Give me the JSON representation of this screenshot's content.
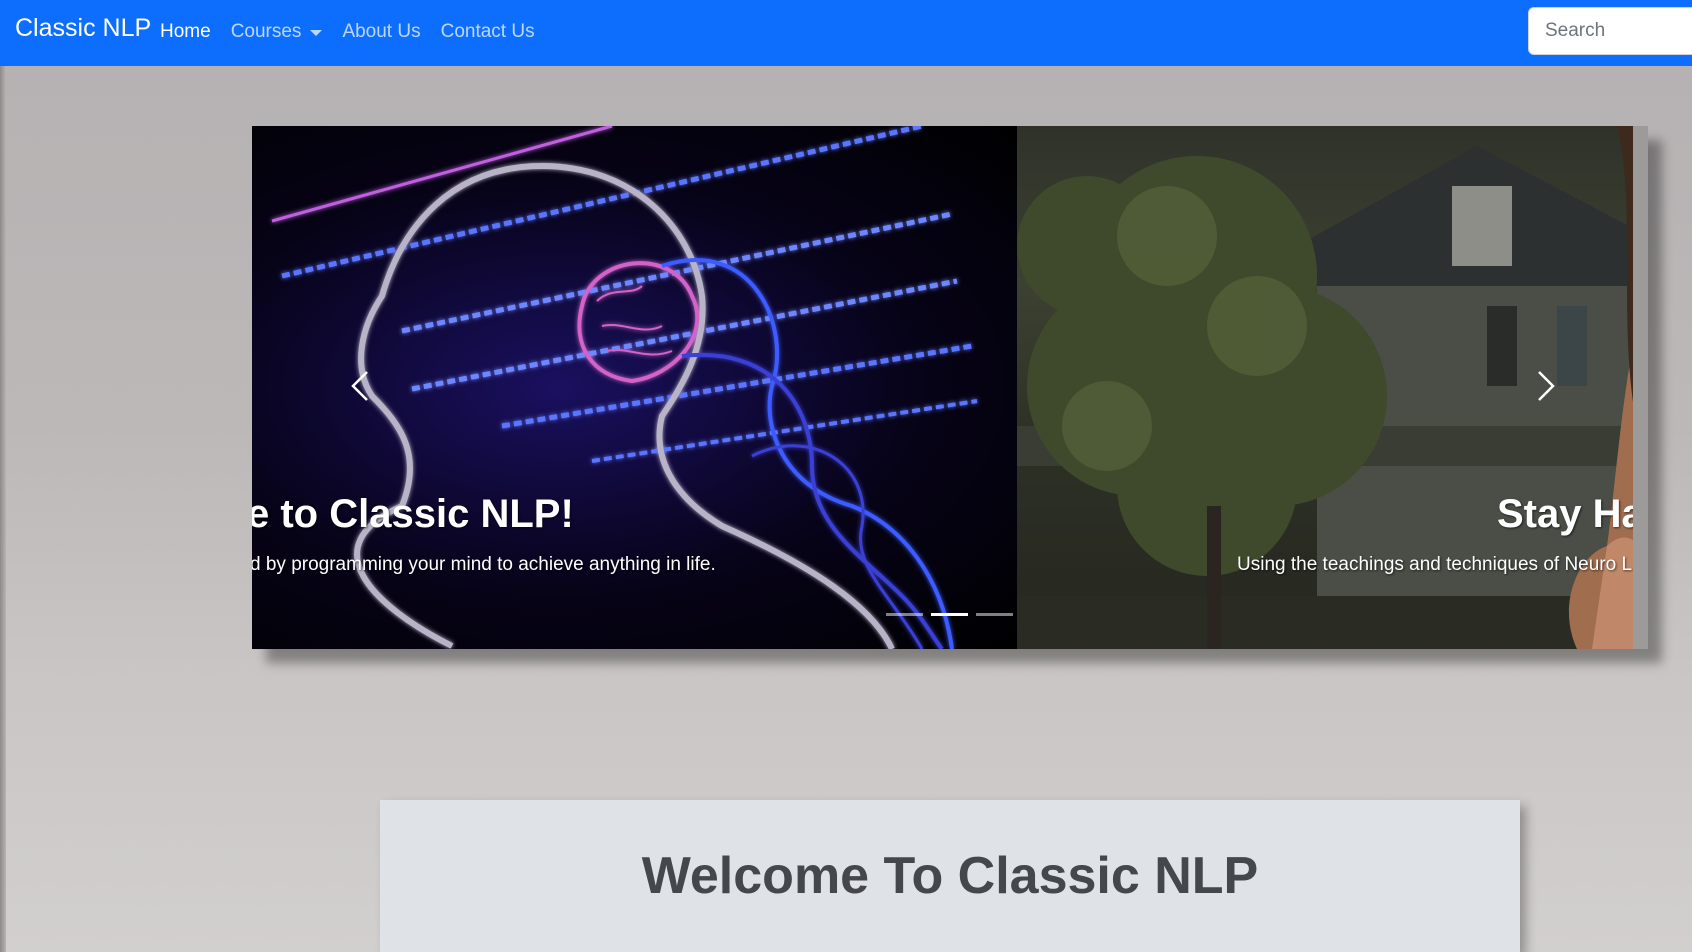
{
  "navbar": {
    "brand": "Classic NLP",
    "links": [
      {
        "label": "Home",
        "active": true
      },
      {
        "label": "Courses",
        "dropdown": true
      },
      {
        "label": "About Us"
      },
      {
        "label": "Contact Us"
      }
    ],
    "search_placeholder": "Search",
    "color": "#0d6efd"
  },
  "carousel": {
    "slides": [
      {
        "title": "e to Classic NLP!",
        "text": "d by programming your mind to achieve anything in life."
      },
      {
        "title": "Stay Ha",
        "text": "Using the teachings and techniques of Neuro L"
      }
    ],
    "indicator_count": 3,
    "active_indicator": 1,
    "prev_icon": "chevron-left-icon",
    "next_icon": "chevron-right-icon"
  },
  "welcome": {
    "heading": "Welcome To Classic NLP"
  }
}
